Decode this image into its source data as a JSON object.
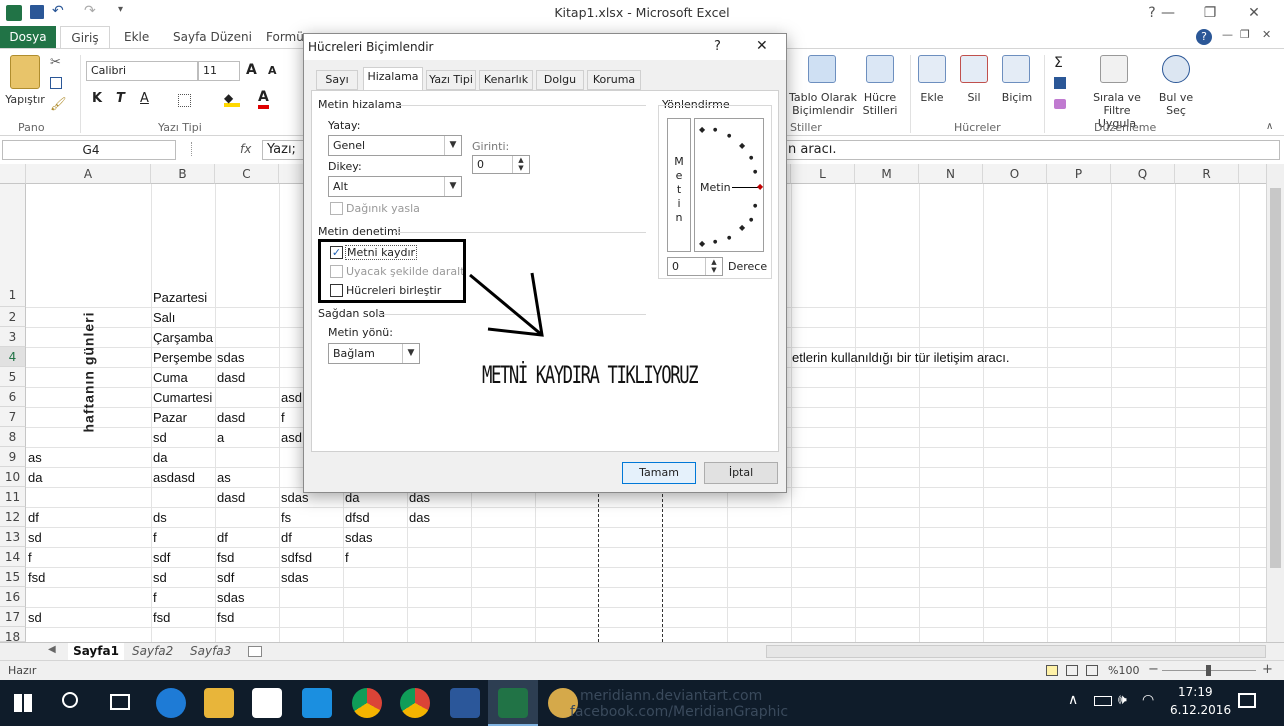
{
  "window": {
    "title": "Kitap1.xlsx - Microsoft Excel",
    "help_glyph": "?",
    "minimize_glyph": "—",
    "restore_glyph": "❐",
    "close_glyph": "✕"
  },
  "ribbon_tabs": [
    "Dosya",
    "Giriş",
    "Ekle",
    "Sayfa Düzeni",
    "Formü"
  ],
  "ribbon": {
    "paste_label": "Yapıştır",
    "clipboard_group": "Pano",
    "font_name": "Calibri",
    "font_size": "11",
    "grow_font": "A",
    "shrink_font": "A",
    "bold": "K",
    "italic": "T",
    "underline": "A",
    "font_color_glyph": "A",
    "font_group": "Yazı Tipi",
    "table_format_label1": "Tablo Olarak",
    "table_format_label2": "Biçimlendir",
    "cell_styles_label1": "Hücre",
    "cell_styles_label2": "Stilleri",
    "styles_group": "Stiller",
    "insert_label": "Ekle",
    "delete_label": "Sil",
    "format_label": "Biçim",
    "cells_group": "Hücreler",
    "sum_glyph": "Σ",
    "sort_label1": "Sırala ve Filtre",
    "sort_label2": "Uygula",
    "find_label1": "Bul ve",
    "find_label2": "Seç",
    "editing_group": "Düzenleme"
  },
  "formula_bar": {
    "name_box": "G4",
    "fx": "fx",
    "content_left": "Yazı;",
    "content_right": "n aracı."
  },
  "columns": [
    "A",
    "B",
    "C",
    "L",
    "M",
    "N",
    "O",
    "P",
    "Q",
    "R"
  ],
  "rows": [
    "1",
    "2",
    "3",
    "4",
    "5",
    "6",
    "7",
    "8",
    "9",
    "10",
    "11",
    "12",
    "13",
    "14",
    "15",
    "16",
    "17",
    "18"
  ],
  "merged_vertical_text": "haftanın günleri",
  "cells": {
    "b1": "Pazartesi",
    "b2": "Salı",
    "b3": "Çarşamba",
    "b4": "Perşembe",
    "c4": "sdas",
    "l4": "etlerin kullanıldığı bir tür iletişim aracı.",
    "b5": "Cuma",
    "c5": "dasd",
    "b6": "Cumartesi",
    "d6": "asd",
    "b7": "Pazar",
    "c7": "dasd",
    "d7": "f",
    "b8": "sd",
    "c8": "a",
    "d8": "asd",
    "a9": "as",
    "b9": "da",
    "a10": "da",
    "b10": "asdasd",
    "c10": "as",
    "c11": "dasd",
    "d11": "sdas",
    "e11": "da",
    "f11": "das",
    "a12": "df",
    "b12": "ds",
    "d12": "fs",
    "e12": "dfsd",
    "f12": "das",
    "a13": "sd",
    "b13": "f",
    "c13": "df",
    "d13": "df",
    "e13": "sdas",
    "a14": "f",
    "b14": "sdf",
    "c14": "fsd",
    "d14": "sdfsd",
    "e14": "f",
    "a15": "fsd",
    "b15": "sd",
    "c15": "sdf",
    "d15": "sdas",
    "b16": "f",
    "c16": "sdas",
    "a17": "sd",
    "b17": "fsd",
    "c17": "fsd"
  },
  "sheets": [
    "Sayfa1",
    "Sayfa2",
    "Sayfa3"
  ],
  "status": {
    "ready": "Hazır",
    "zoom": "%100",
    "zoom_minus": "−",
    "zoom_plus": "+"
  },
  "taskbar": {
    "time": "17:19",
    "date": "6.12.2016",
    "watermark1": "meridiann.deviantart.com",
    "watermark2": "facebook.com/MeridianGraphic"
  },
  "dialog": {
    "title": "Hücreleri Biçimlendir",
    "help": "?",
    "close": "✕",
    "tabs": [
      "Sayı",
      "Hizalama",
      "Yazı Tipi",
      "Kenarlık",
      "Dolgu",
      "Koruma"
    ],
    "text_alignment_header": "Metin hizalama",
    "horizontal_label": "Yatay:",
    "horizontal_value": "Genel",
    "indent_label": "Girinti:",
    "indent_value": "0",
    "vertical_label": "Dikey:",
    "vertical_value": "Alt",
    "distributed_label": "Dağınık yasla",
    "text_control_header": "Metin denetimi",
    "wrap_text_label": "Metni kaydır",
    "wrap_text_checked": "✓",
    "shrink_label": "Uyacak şekilde daralt",
    "merge_label": "Hücreleri birleştir",
    "rtl_header": "Sağdan sola",
    "direction_label": "Metin yönü:",
    "direction_value": "Bağlam",
    "orientation_header": "Yönlendirme",
    "vertical_text": [
      "M",
      "e",
      "t",
      "i",
      "n"
    ],
    "orientation_text": "Metin",
    "degree_value": "0",
    "degree_label": "Derece",
    "ok_label": "Tamam",
    "cancel_label": "İptal",
    "annotation": "METNİ KAYDIRA TIKLIYORUZ"
  }
}
